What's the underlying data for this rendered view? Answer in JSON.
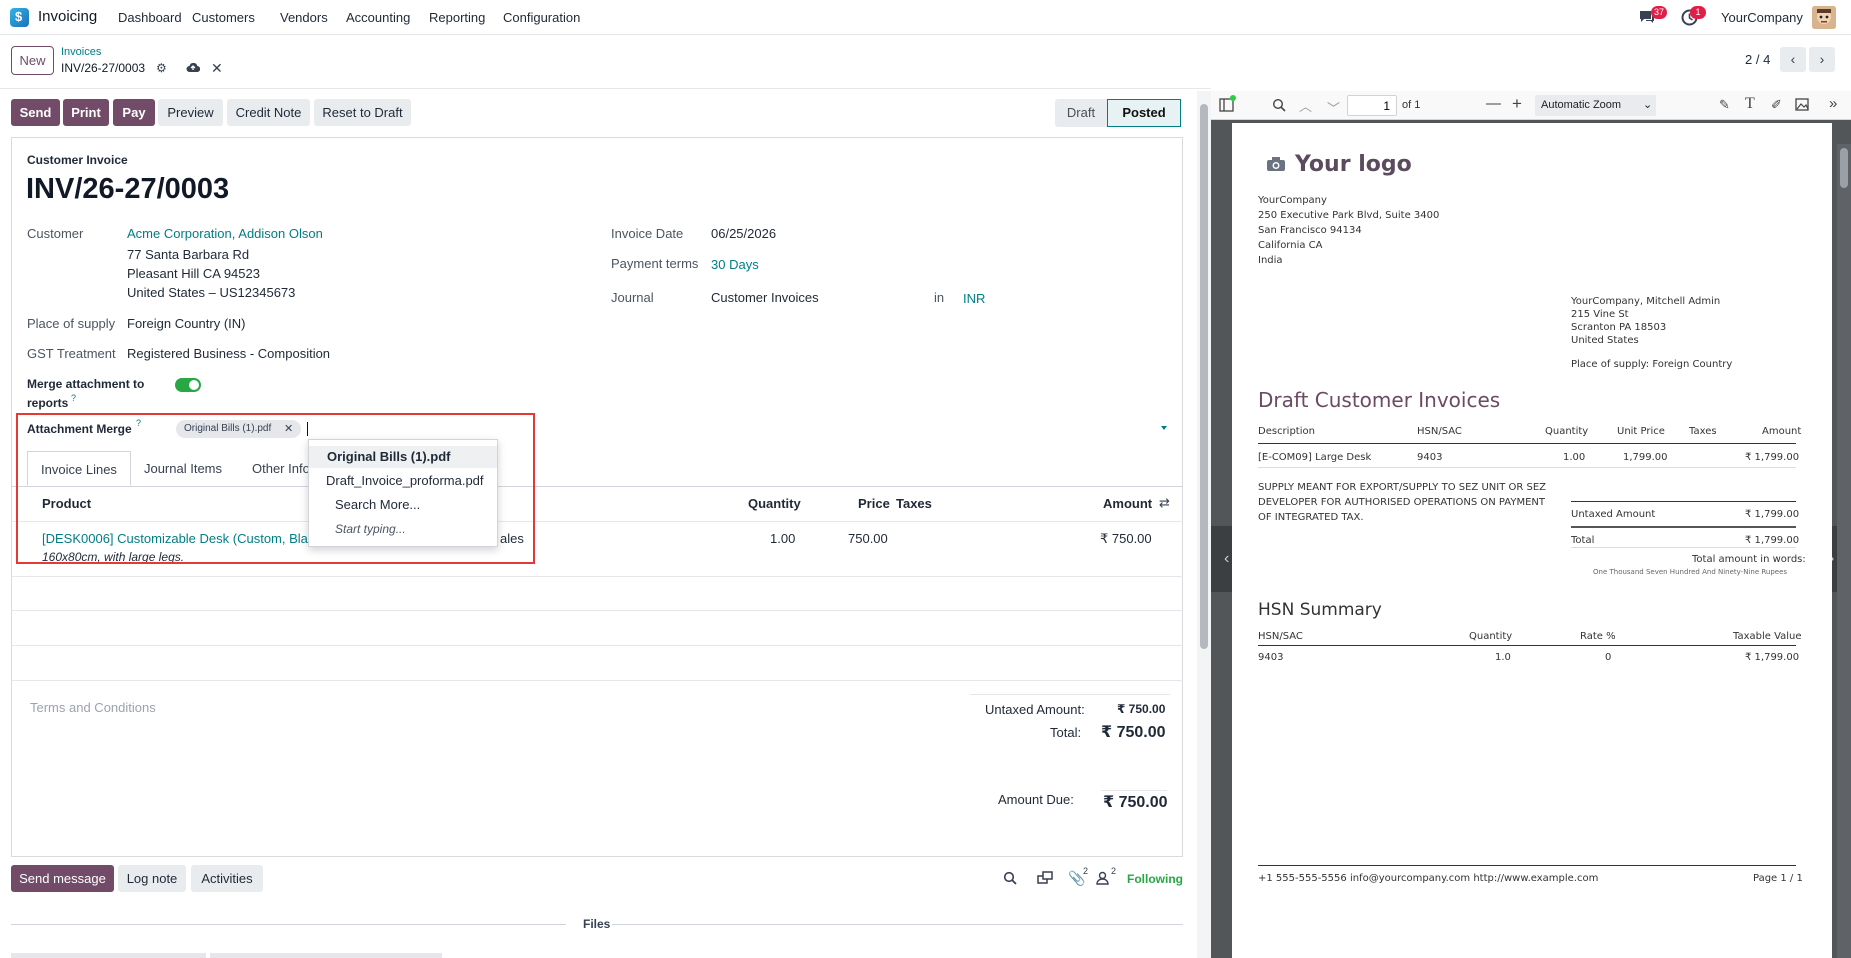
{
  "topnav": {
    "app_name": "Invoicing",
    "menu": [
      "Dashboard",
      "Customers",
      "Vendors",
      "Accounting",
      "Reporting",
      "Configuration"
    ],
    "messages_count": "37",
    "activities_count": "1",
    "company": "YourCompany"
  },
  "breadcrumb": {
    "new_label": "New",
    "parent": "Invoices",
    "current": "INV/26-27/0003",
    "pager": "2 / 4"
  },
  "actions": {
    "send": "Send",
    "print": "Print",
    "pay": "Pay",
    "preview": "Preview",
    "credit_note": "Credit Note",
    "reset": "Reset to Draft"
  },
  "status": {
    "draft": "Draft",
    "posted": "Posted"
  },
  "form": {
    "doc_type": "Customer Invoice",
    "name": "INV/26-27/0003",
    "customer_label": "Customer",
    "customer": "Acme Corporation, Addison Olson",
    "address1": "77 Santa Barbara Rd",
    "address2": "Pleasant Hill CA 94523",
    "address3": "United States – US12345673",
    "place_label": "Place of supply",
    "place": "Foreign Country (IN)",
    "gst_label": "GST Treatment",
    "gst": "Registered Business - Composition",
    "merge_label_1": "Merge attachment to",
    "merge_label_2": "reports",
    "attach_label": "Attachment Merge",
    "attach_tag": "Original Bills (1).pdf",
    "invoice_date_label": "Invoice Date",
    "invoice_date": "06/25/2026",
    "payment_terms_label": "Payment terms",
    "payment_terms": "30 Days",
    "journal_label": "Journal",
    "journal": "Customer Invoices",
    "in_label": "in",
    "currency": "INR"
  },
  "tabs": [
    "Invoice Lines",
    "Journal Items",
    "Other Info"
  ],
  "lines": {
    "headers": {
      "product": "Product",
      "quantity": "Quantity",
      "price": "Price",
      "taxes": "Taxes",
      "amount": "Amount"
    },
    "row": {
      "product": "[DESK0006] Customizable Desk (Custom, Black",
      "product_tail": "ales",
      "description": "160x80cm, with large legs.",
      "quantity": "1.00",
      "price": "750.00",
      "amount": "₹ 750.00"
    }
  },
  "dropdown": {
    "items": [
      "Original Bills (1).pdf",
      "Draft_Invoice_proforma.pdf"
    ],
    "search_more": "Search More...",
    "start_typing": "Start typing..."
  },
  "totals": {
    "terms_placeholder": "Terms and Conditions",
    "untaxed_label": "Untaxed Amount:",
    "untaxed": "₹ 750.00",
    "total_label": "Total:",
    "total": "₹ 750.00",
    "due_label": "Amount Due:",
    "due": "₹ 750.00"
  },
  "chatter": {
    "send_message": "Send message",
    "log_note": "Log note",
    "activities": "Activities",
    "attachments_count": "2",
    "followers_count": "2",
    "following": "Following",
    "files": "Files"
  },
  "pdf_viewer": {
    "page_input": "1",
    "of_pages": "of 1",
    "zoom": "Automatic Zoom",
    "logo": "Your logo",
    "company_lines": [
      "YourCompany",
      "250 Executive Park Blvd, Suite 3400",
      "San Francisco 94134",
      "California CA",
      "India"
    ],
    "partner_lines": [
      "YourCompany, Mitchell Admin",
      "215 Vine St",
      "Scranton PA 18503",
      "United States"
    ],
    "place_of_supply": "Place of supply: Foreign Country",
    "title": "Draft Customer Invoices",
    "table_headers": [
      "Description",
      "HSN/SAC",
      "Quantity",
      "Unit Price",
      "Taxes",
      "Amount"
    ],
    "table_row": [
      "[E-COM09] Large Desk",
      "9403",
      "1.00",
      "1,799.00",
      "",
      "₹ 1,799.00"
    ],
    "note_lines": [
      "SUPPLY MEANT FOR EXPORT/SUPPLY TO SEZ UNIT OR SEZ",
      "DEVELOPER FOR AUTHORISED OPERATIONS ON PAYMENT",
      "OF INTEGRATED TAX."
    ],
    "untaxed_label": "Untaxed Amount",
    "untaxed": "₹ 1,799.00",
    "total_label": "Total",
    "total": "₹ 1,799.00",
    "words_label": "Total amount in words:",
    "words": "One Thousand Seven Hundred And Ninety-Nine Rupees",
    "hsn_title": "HSN Summary",
    "hsn_headers": [
      "HSN/SAC",
      "Quantity",
      "Rate %",
      "Taxable Value"
    ],
    "hsn_row": [
      "9403",
      "1.0",
      "0",
      "₹ 1,799.00"
    ],
    "footer_contact": "+1 555-555-5556 info@yourcompany.com http://www.example.com",
    "footer_page": "Page 1 / 1"
  }
}
